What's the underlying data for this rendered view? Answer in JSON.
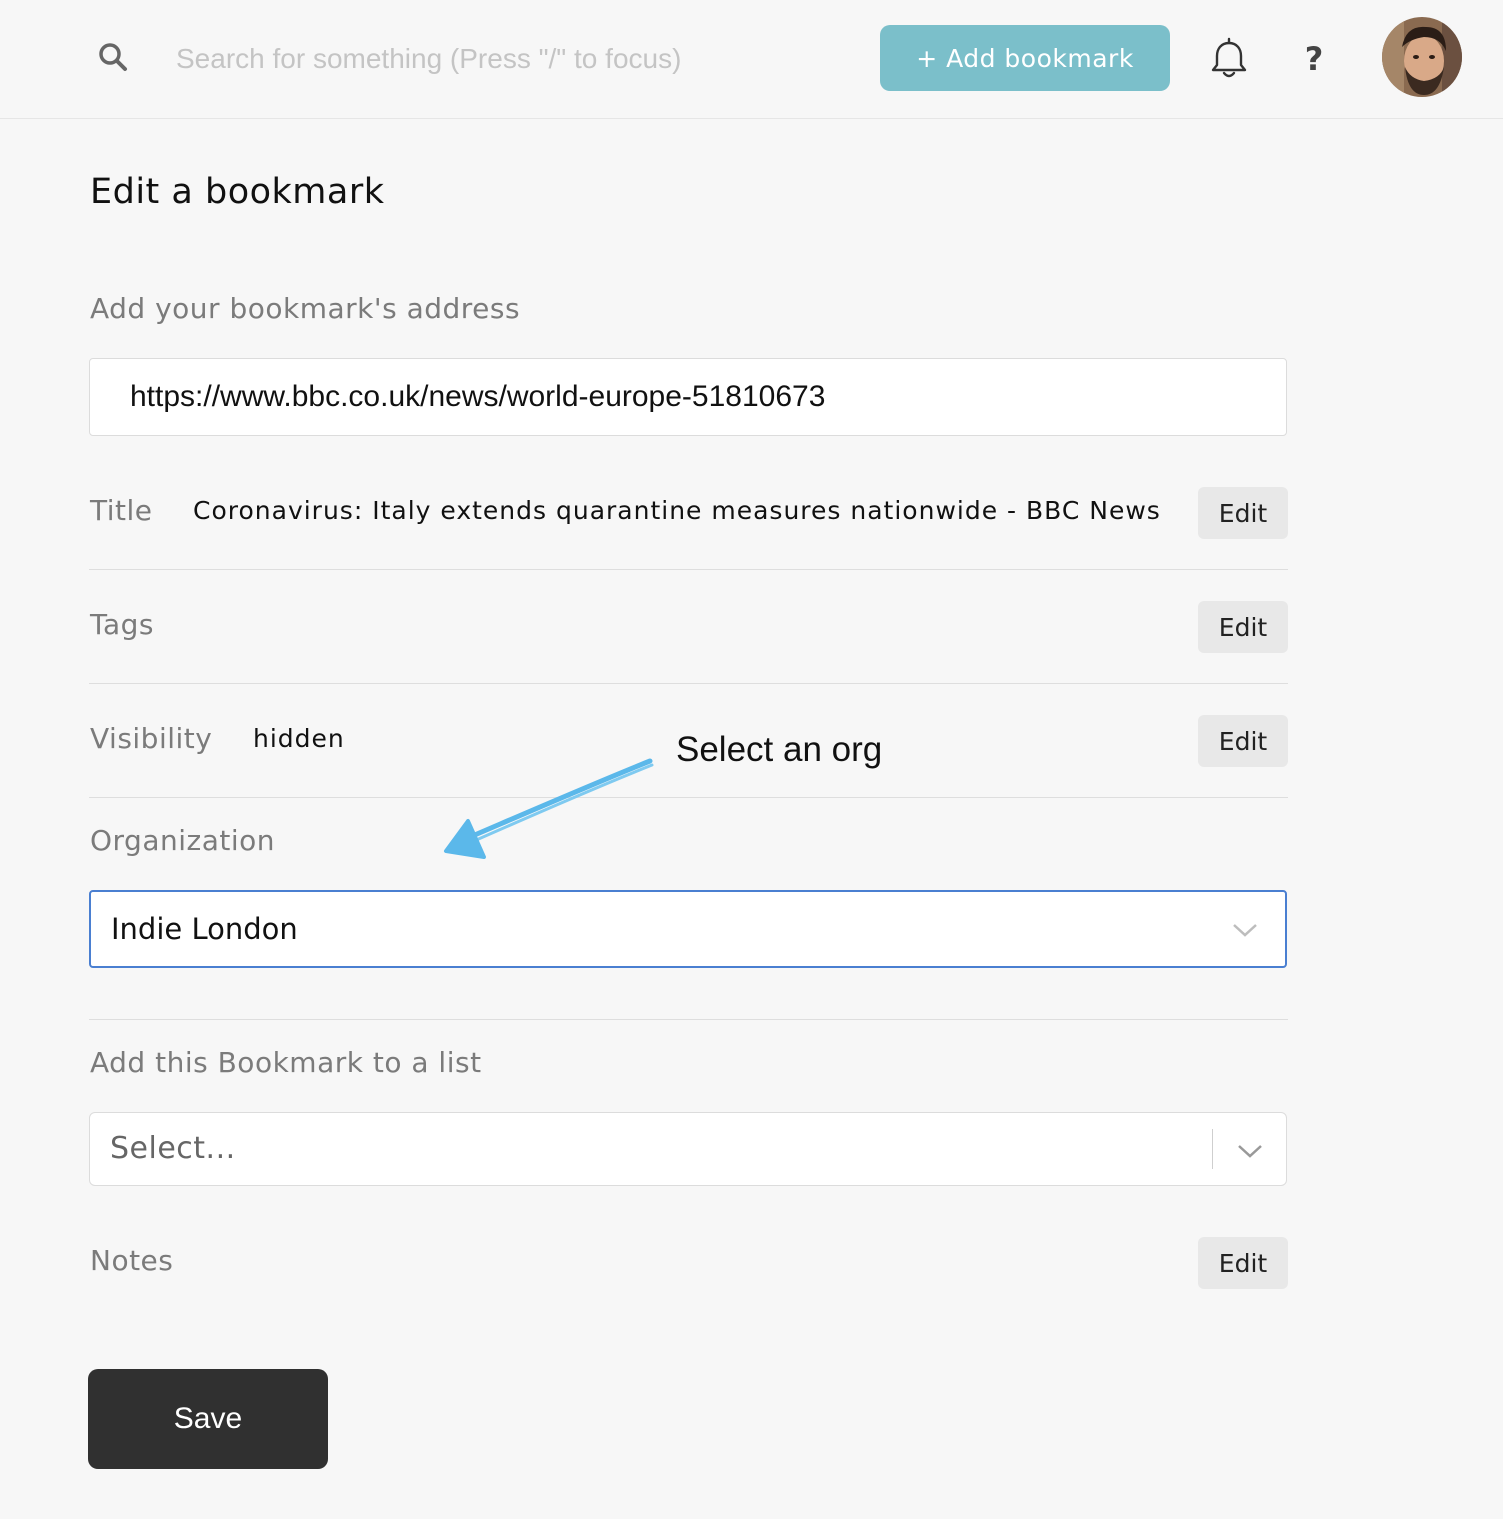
{
  "header": {
    "search_placeholder": "Search for something (Press \"/\" to focus)",
    "add_bookmark_label": "+ Add bookmark",
    "help_label": "?",
    "accent_color": "#7bbfca"
  },
  "page": {
    "title": "Edit a bookmark"
  },
  "address": {
    "label": "Add your bookmark's address",
    "value": "https://www.bbc.co.uk/news/world-europe-51810673"
  },
  "fields": {
    "title": {
      "label": "Title",
      "value": "Coronavirus: Italy extends quarantine measures nationwide - BBC News",
      "edit_label": "Edit"
    },
    "tags": {
      "label": "Tags",
      "edit_label": "Edit"
    },
    "visibility": {
      "label": "Visibility",
      "value": "hidden",
      "edit_label": "Edit"
    },
    "notes": {
      "label": "Notes",
      "edit_label": "Edit"
    }
  },
  "organization": {
    "label": "Organization",
    "selected": "Indie London",
    "focus_color": "#4a7fd1"
  },
  "list": {
    "label": "Add this Bookmark to a list",
    "placeholder": "Select..."
  },
  "annotation": {
    "text": "Select an org",
    "arrow_color": "#5bb8ea"
  },
  "save_label": "Save"
}
